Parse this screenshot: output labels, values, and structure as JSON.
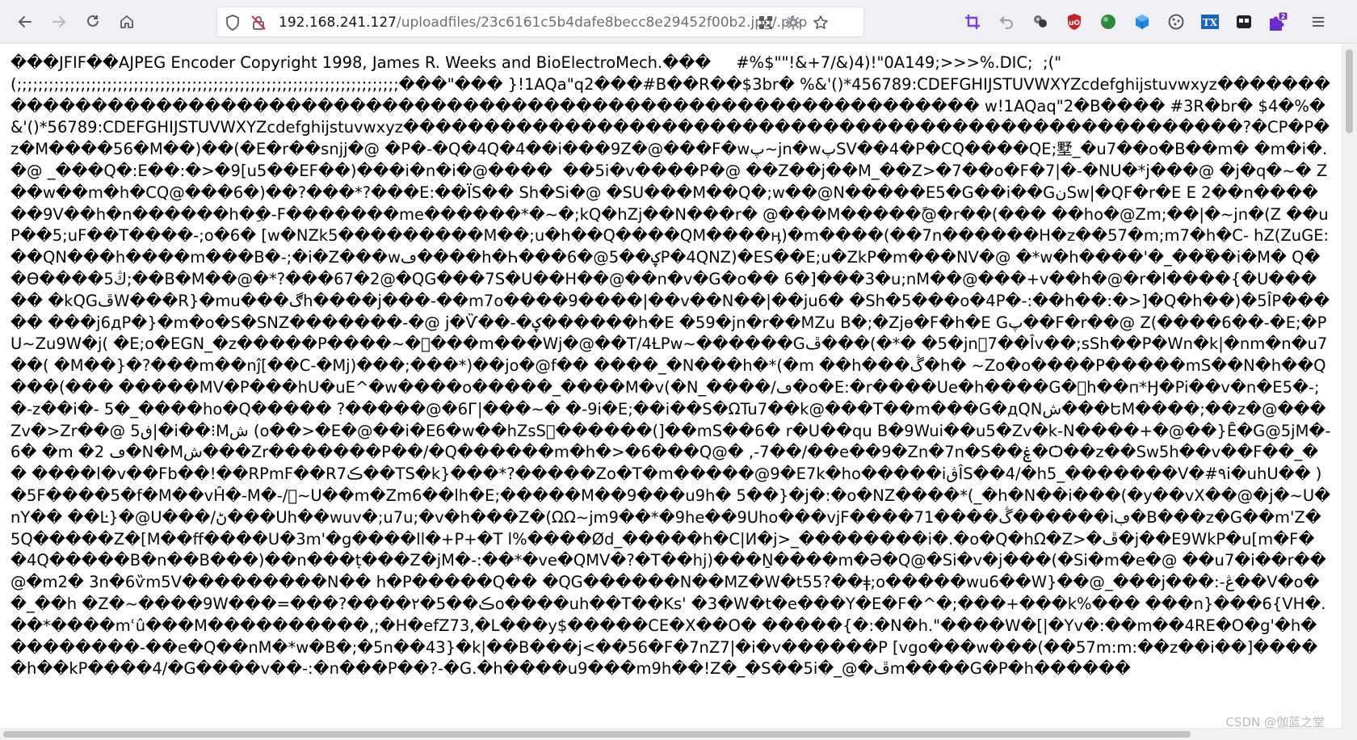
{
  "browser": {
    "url_host": "192.168.241.127",
    "url_path": "/uploadfiles/23c6161c5b4dafe8becc8e29452f00b2.jpg/.php",
    "icons": {
      "back": "back-arrow-icon",
      "forward": "forward-arrow-icon",
      "reload": "reload-icon",
      "home": "home-icon",
      "shield": "tracking-protection-shield-icon",
      "insecure": "insecure-connection-icon",
      "qr": "qr-code-icon",
      "extension": "extension-gear-icon",
      "bookmark": "bookmark-star-icon"
    },
    "extensions": [
      {
        "name": "crop-icon",
        "color": "#7b3fe4"
      },
      {
        "name": "undo-icon",
        "color": "#9c9ca6"
      },
      {
        "name": "pinwheel-icon",
        "color": "#5a5a5a"
      },
      {
        "name": "ublock-icon",
        "color": "#c0262d"
      },
      {
        "name": "green-ball-icon",
        "color": "#2b8a3e"
      },
      {
        "name": "blue-cube-icon",
        "color": "#1e88e5"
      },
      {
        "name": "cookie-icon",
        "color": "#4a4a4a"
      },
      {
        "name": "translate-tx-icon",
        "color": "#1565c0",
        "label": "TX"
      },
      {
        "name": "container-icon",
        "color": "#222222"
      },
      {
        "name": "puzzle-badge-icon",
        "color": "#6a2bd1",
        "badge": "2"
      },
      {
        "name": "menu-icon",
        "color": "#5b5b66"
      }
    ]
  },
  "page": {
    "raw_text": "���JFIF��AJPEG Encoder Copyright 1998, James R. Weeks and BioElectroMech.���     #%$\"\"!&+7/&)4)!\"0A149;>>>%.DIC;  ;(\"(;;;;;;;;;;;;;;;;;;;;;;;;;;;;;;;;;;;;;;;;;;;;;;;;;;;;;;;;;;;;;;;;;;;;;;;;���\"��� }!1AQa\"q2���#B��R��$3br� %&'()*456789:CDEFGHIJSTUVWXYZcdefghijstuvwxyz������������������������������������������������������������������� w!1AQaq\"2�B���� #3R�br� $4�%� &'()*56789:CDEFGHIJSTUVWXYZcdefghijstuvwxyz����������������������������������������������������?�CP�P�z�M����56�M��)��(�E�r��snjj�@ �P�-�Q�4Q�4��i���9Z�@���F�wپ~jn�wپSV��4�P�CQ����QE;墅_�u7��o�B��m� �m�i�.�@ _���Q�:E��:�>�9[u5��EF��)���i�n�i�@����  ��5i�v����P�@ ��Z��j��M_��Z>�7��o�F�7|�-�NU�*j���@ �j�q�~� Z��w��m�h�CQ@���6�)��?���*?���E:��ÏS�� Sh�Si�@ �SU���M��Q�;w��@N�����E5�G��i��GنSw|�QF�r�E E 2��n������9V��h�n������h��ِ-F�������me������*�~�;kQ�hZj��N���r� @���M�����@ً�r��(��� ��ho�@Zm;��|�~jn�(Z ��uP��5;uF��T����-;o�6� [w�NZk5���������M��;u�h��Q����QM����ӊ)�m����(��7n������H�z��57�m;m7�h�C- hZ(ZuGE:��QN���h����m���B�-;�i�Z���wڡ����h�Һ���6�@ؼ��5P�4QNZ)�ES��E;u�ZkP�m���NV�@ �*w�h����'�_���ْ�i�M� Q��Ө����5ڭ;��B�M��@�*?���67�2@�QG���7S�U��H��@��n�v�G�o�� 6�]ٛ���3�u;nM��@���+v��h�@�r�l����{�U����� �kQGڦW���R}�mu���ڰh����j���-��m7o����9����|��v��N��|��ju6� �Sh�5���o�4P�-:��h��:�>]�Q�h��)�5ÎP����� ���j6дP�}�m�o�S�SNZ�������-�@ j�Ѷ��-�ؼ������h�E �59�jn�r��MZu B�;�Zjө�F�h�E Gپ��F�r��@ Z(����6��-�E;�PU~Zu9W�j( �E;o�EGN_�z�����P����~�ᷚ���m���Wj�@��T/4ȽPw~������Gڦ���(�*� �5�jnᷚ7��Îv��;sSh��P�Wn�k|�nm�n�u7��( �M��}�?���m��nĵ[��C-�Mj)���;���*)��jo�@f�� ����_�N���h�*(�m ��h���ڴ�h� ~Zo�o����P�����mS��N�h��Q���(��� �����MV�P���hU�uE^�w����o�����_����M�v(�N_����/ڡ�o�E:�r����Ue�h����G�ᷚh��п*Ӈ�Pi��v�n�E5�-;�-z��i�- 5�_����ho�Q����� ?�����@�6Г|���~� �-9i�E;��i��S�ΩTu7��k@���T��m���G�дQNش���ԵM����;��z�@���Zv�>Zr��@ 5ڧ|�i��⁝Mش (o��>�E�@��i�E6�w��hZsSᷙ������(]��mS��6� r�U��qu B�9Wui��u5�Zv�k-N����+�@��}Ȇ�G@5jM�-6� �m �ڡ 2�N�Mش���Zr�������P��/�Q������m�h�>�6���Q@� ,-7��/��e��9�Zn�7n�S��ۼ�Ѻ��z��Sw5h��v��F��_�� ����l�v��Fb��!��RPmF��R7ڪ��TS�k}���*?�����Zo�T�m�����@9�E7k�ho�����iڨÎS��4/�h5_�������V�#٩i�uhU�� )�5F����5�f�M��vĤ�-M�-/ᷚ~U��m�Zm6��lh�E;�����M��9���u9h� 5��}�j�:�o�NZ����*(_�h�N��i���(�y��vX��@�j�~U�nY�� ��Ŀ}�@U���/ڻ���Uh��wuv�;u7u;�v�h���Z�(ΩΩ~jm9��*�9he��9Uho���vjF����71����ڴ������iڢ�B���z�G��m'Z� 5Q�����Z�[M��ff����U�3m'�g����ll�+P+�T l%����Ød_�����h�C|И�j>_��������i�.�o�Q�hΩ�Z>�ڦ�j��E9WkP�u[m�F� �4Q�����B�n��B���)��n���ṭ���Z�jM�-:��*�ve�QMV�?�T��hj)���Ṉ����m�Ә�Q@�Si�v�j���(�Si�m�e�@ ��u7�i��r��@�m2� 3n�6ѷm5V���������N�� h�P�����Q�� �QG������N��MZ�W�t55?��ǂ;o�����wu6��W}��@_���j���:-ڠ��V�o��_��h �Z�~����9W���=���?����۲�5��ڪo����uh��T��Ks' �3�W�t�e���Y�E�F�^�;���+���k%��� ���n}���6{VH�.��*����mʿû���M����������,;�H�efZ73,�L���y$�����CE�X��O� �����{�:�N�h.\"����W�[|�Yv�:��m��4RE�O�g'�h���������-��e�Q��nM�*w�B�;�5n��43}�k|��B���j<��56�F�7nZ7|�i�v������P [vgo���w���(��57m:m:��z��i��]�����h��kP����4/�G����v��-:�n���P��?-�G.�h����u9���m9h��!Z�_�S��5i�_@�ڦm����G�P�h������"
  },
  "watermark": {
    "text": "CSDN @伽蓝之堂"
  }
}
